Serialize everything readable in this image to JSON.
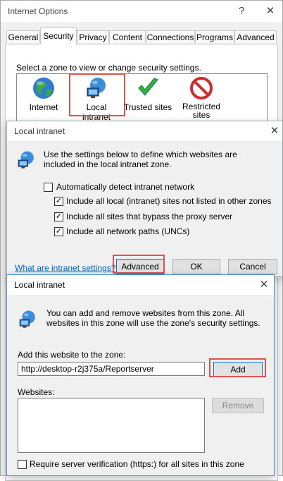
{
  "main_window": {
    "title": "Internet Options",
    "help_glyph": "?",
    "close_glyph": "✕",
    "tabs": [
      "General",
      "Security",
      "Privacy",
      "Content",
      "Connections",
      "Programs",
      "Advanced"
    ],
    "active_tab": "Security",
    "zone_prompt": "Select a zone to view or change security settings.",
    "zones": [
      {
        "label": "Internet",
        "icon": "globe-icon"
      },
      {
        "label": "Local intranet",
        "icon": "intranet-icon"
      },
      {
        "label": "Trusted sites",
        "icon": "checkmark-icon"
      },
      {
        "label": "Restricted sites",
        "icon": "restricted-icon"
      }
    ]
  },
  "intranet_dialog": {
    "title": "Local intranet",
    "close_glyph": "✕",
    "description": "Use the settings below to define which websites are included in the local intranet zone.",
    "auto_detect_label": "Automatically detect intranet network",
    "auto_detect_checked": false,
    "options": [
      {
        "label": "Include all local (intranet) sites not listed in other zones",
        "checked": true
      },
      {
        "label": "Include all sites that bypass the proxy server",
        "checked": true
      },
      {
        "label": "Include all network paths (UNCs)",
        "checked": true
      }
    ],
    "help_link": "What are intranet settings?",
    "advanced_label": "Advanced",
    "ok_label": "OK",
    "cancel_label": "Cancel",
    "check_glyph": "✓"
  },
  "sites_dialog": {
    "title": "Local intranet",
    "close_glyph": "✕",
    "description": "You can add and remove websites from this zone. All websites in this zone will use the zone's security settings.",
    "add_label": "Add this website to the zone:",
    "url_value": "http://desktop-r2j375a/Reportserver",
    "add_button": "Add",
    "websites_label": "Websites:",
    "remove_button": "Remove",
    "https_label": "Require server verification (https:) for all sites in this zone",
    "https_checked": false
  },
  "colors": {
    "highlight": "#d9534f",
    "link": "#0066cc",
    "accent": "#0078d7"
  }
}
